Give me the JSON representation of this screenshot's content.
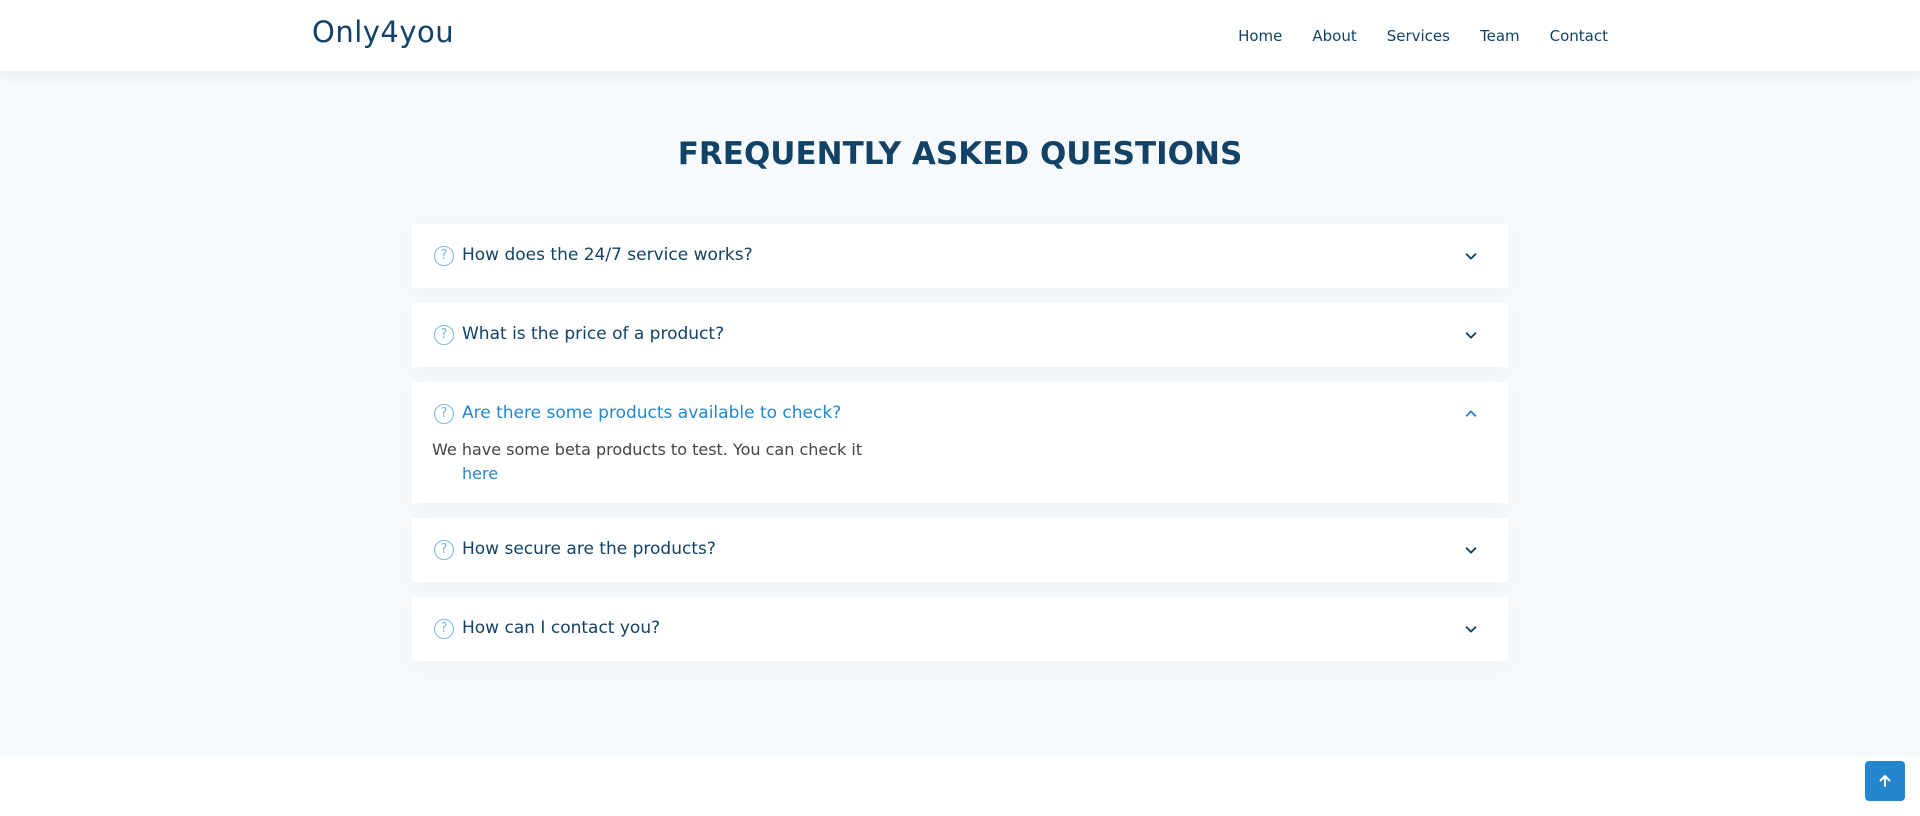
{
  "header": {
    "logo": "Only4you",
    "nav": [
      "Home",
      "About",
      "Services",
      "Team",
      "Contact"
    ]
  },
  "faq": {
    "title": "FREQUENTLY ASKED QUESTIONS",
    "items": [
      {
        "question": "How does the 24/7 service works?",
        "expanded": false
      },
      {
        "question": "What is the price of a product?",
        "expanded": false
      },
      {
        "question": "Are there some products available to check?",
        "expanded": true,
        "answer": "We have some beta products to test. You can check it",
        "answer_link": "here"
      },
      {
        "question": "How secure are the products?",
        "expanded": false
      },
      {
        "question": "How can I contact you?",
        "expanded": false
      }
    ],
    "question_icon_glyph": "?"
  },
  "colors": {
    "primary": "#124265",
    "accent": "#2487ce",
    "icon": "#7cb6e4",
    "section_bg": "#f6fafd"
  },
  "icons": {
    "question": "question-circle-icon",
    "collapsed": "chevron-down-icon",
    "expanded": "chevron-up-icon",
    "back_to_top": "arrow-up-icon"
  }
}
